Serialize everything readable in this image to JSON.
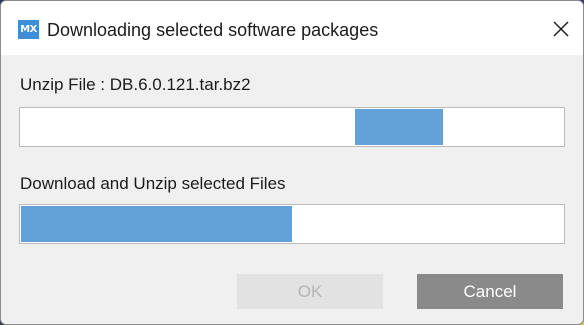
{
  "window": {
    "app_icon_text": "MX",
    "title": "Downloading selected software packages",
    "close_icon": "close-icon"
  },
  "unzip": {
    "label": "Unzip File : DB.6.0.121.tar.bz2",
    "indicator_color": "#63a2d8"
  },
  "download": {
    "label": "Download and Unzip selected Files",
    "progress_fraction": 0.5,
    "fill_color": "#63a2d8"
  },
  "buttons": {
    "ok_label": "OK",
    "ok_enabled": false,
    "cancel_label": "Cancel"
  }
}
